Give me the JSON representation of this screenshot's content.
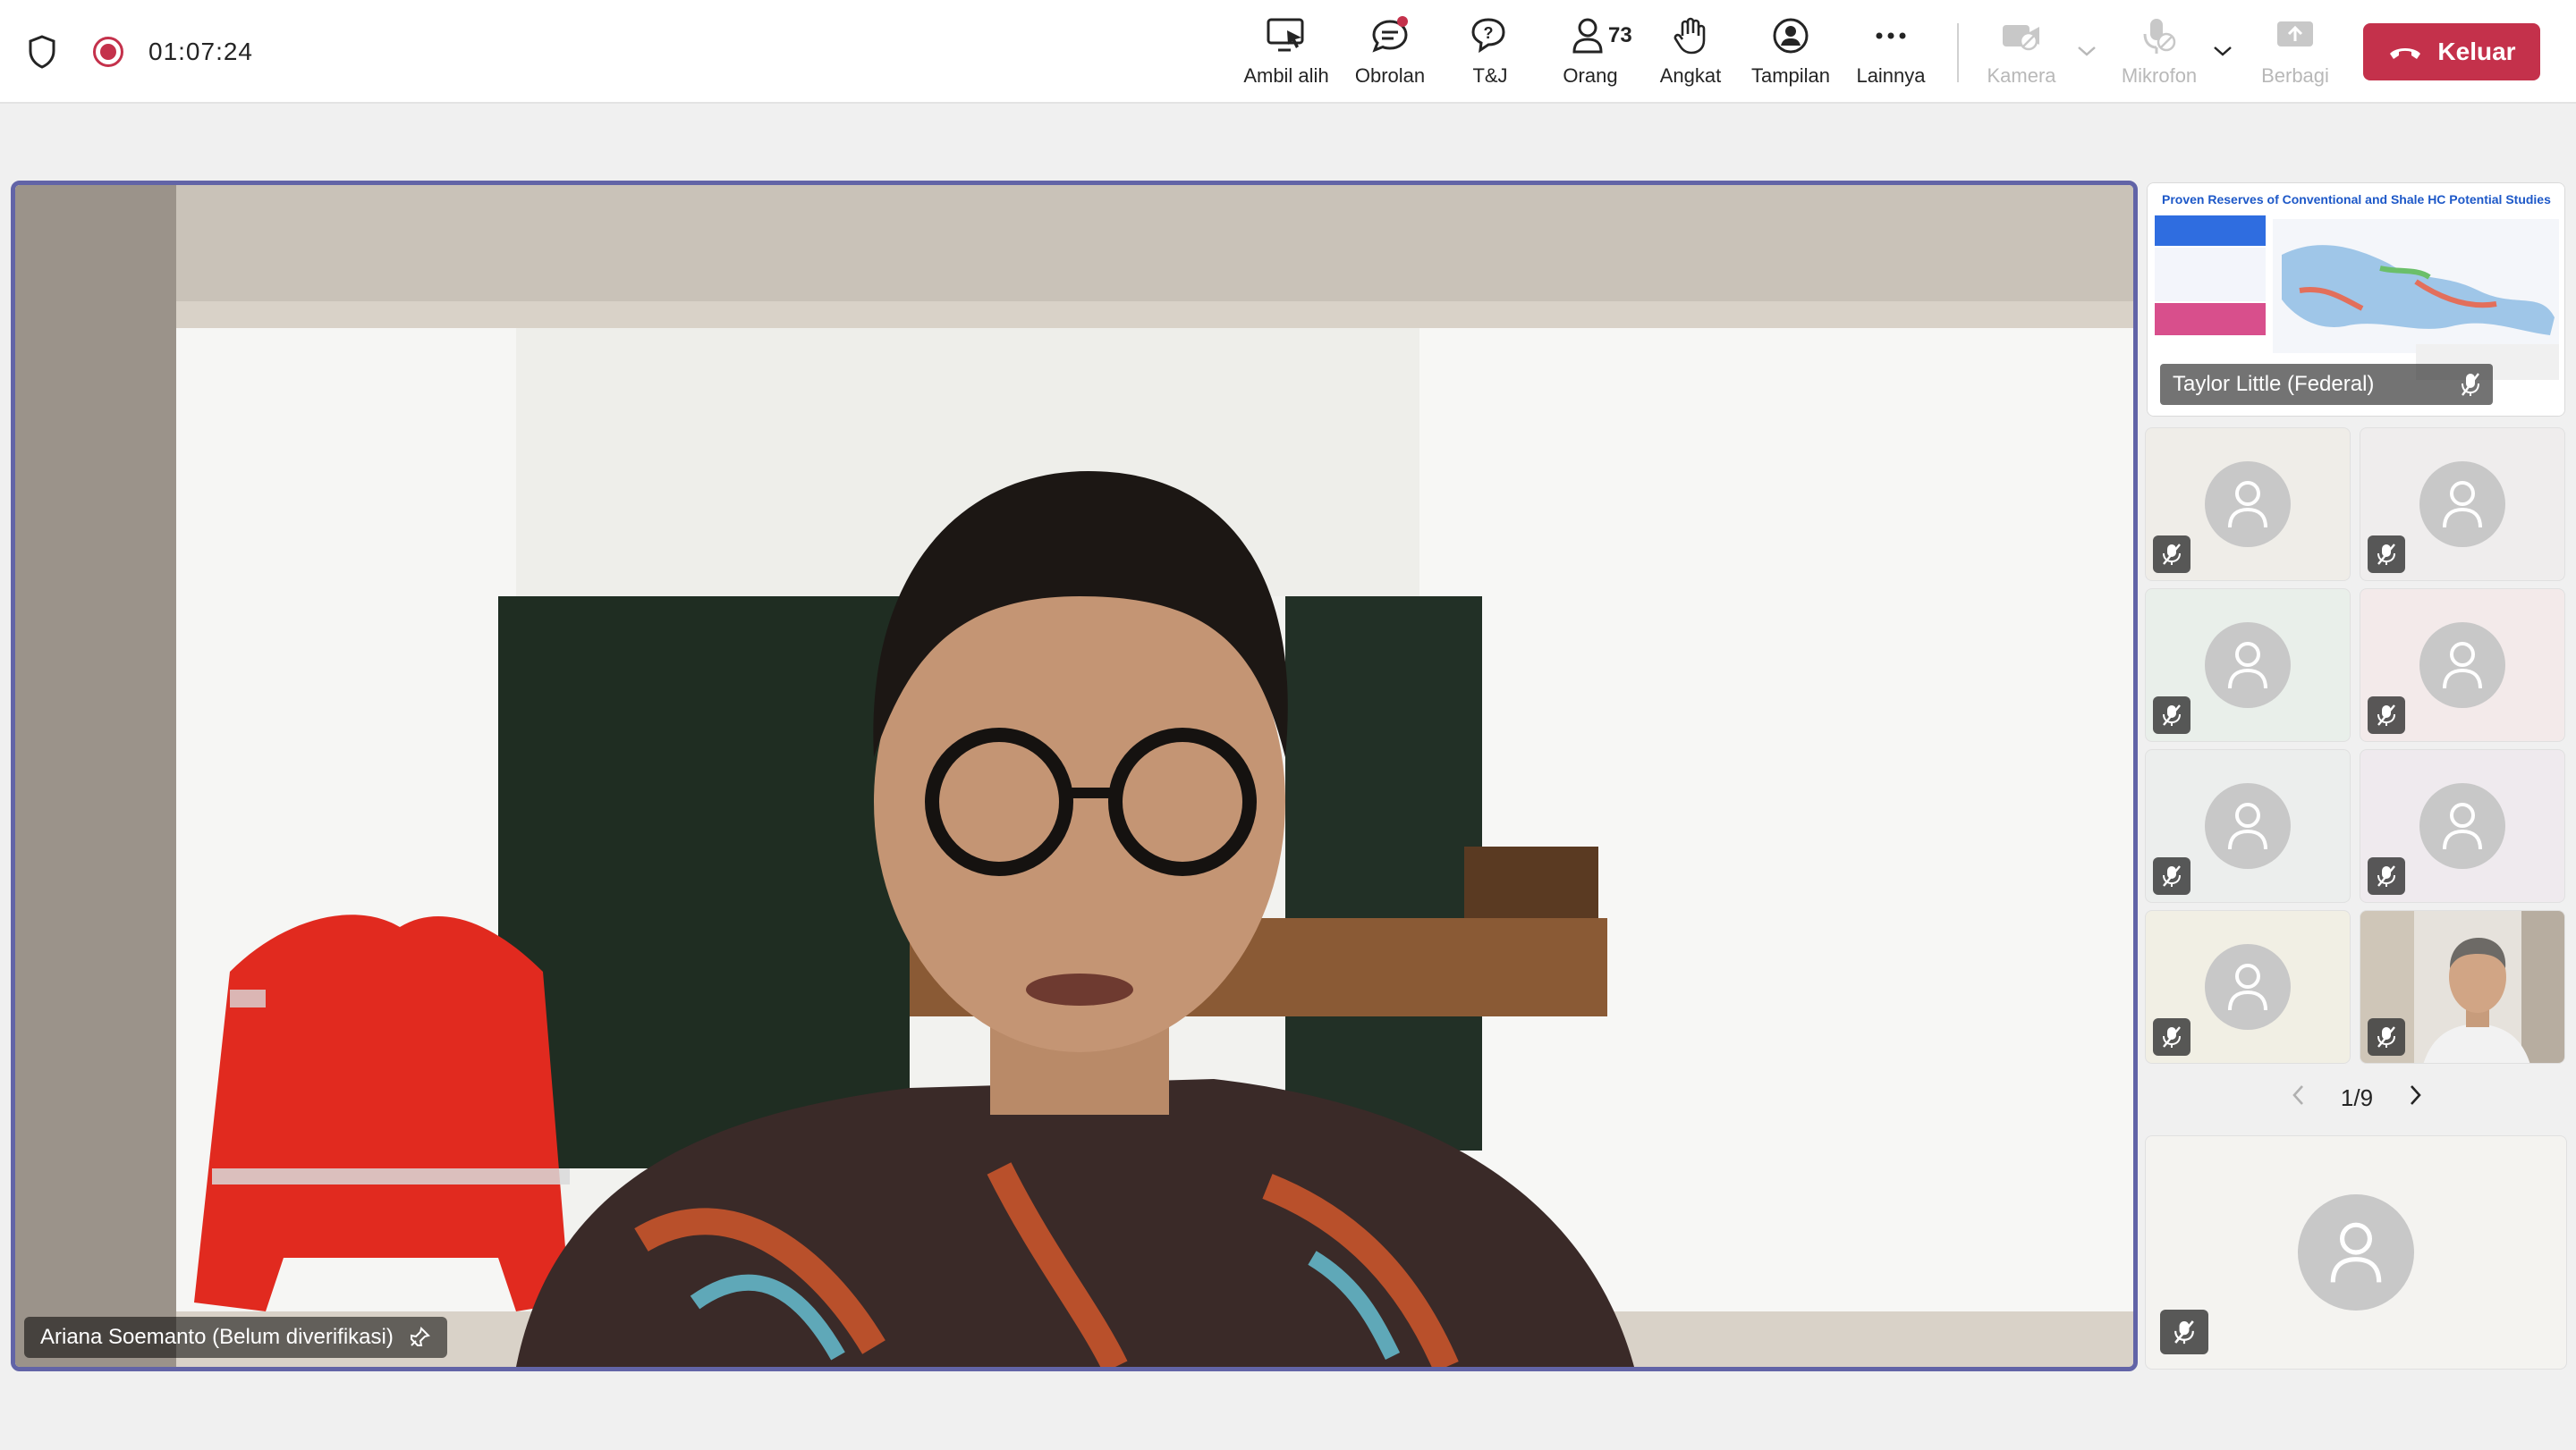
{
  "toolbar": {
    "timer": "01:07:24",
    "tools": [
      {
        "label": "Ambil alih",
        "icon": "take-control-icon"
      },
      {
        "label": "Obrolan",
        "icon": "chat-icon"
      },
      {
        "label": "T&J",
        "icon": "qa-icon"
      },
      {
        "label": "Orang",
        "icon": "people-icon",
        "count": "73"
      },
      {
        "label": "Angkat",
        "icon": "raise-hand-icon"
      },
      {
        "label": "Tampilan",
        "icon": "view-icon"
      },
      {
        "label": "Lainnya",
        "icon": "more-icon"
      },
      {
        "label": "Kamera",
        "icon": "camera-off-icon",
        "disabled": true
      },
      {
        "label": "Mikrofon",
        "icon": "mic-off-icon",
        "disabled": true
      },
      {
        "label": "Berbagi",
        "icon": "share-icon",
        "disabled": true
      }
    ],
    "leave_label": "Keluar"
  },
  "stage": {
    "speaker_name": "Ariana Soemanto (Belum diverifikasi)"
  },
  "screen_share": {
    "slide_title": "Proven Reserves of Conventional and Shale HC Potential Studies",
    "presenter": "Taylor Little (Federal)"
  },
  "gallery": {
    "page": "1/9"
  },
  "colors": {
    "accent": "#6264a7",
    "leave": "#c4314b",
    "record": "#c4314b"
  }
}
